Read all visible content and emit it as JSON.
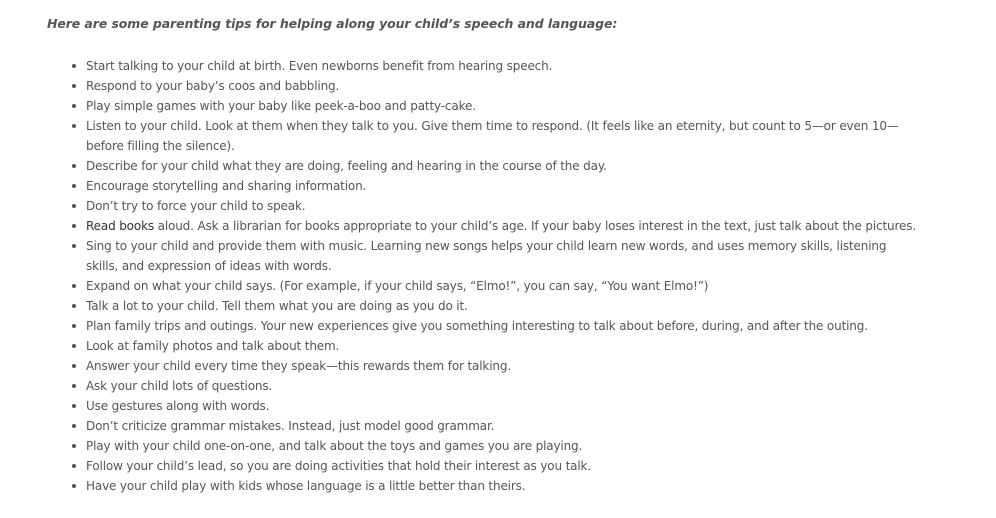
{
  "intro": "Here are some parenting tips for helping along your child’s speech and language:",
  "tips": [
    "Start talking to your child at birth.  Even newborns benefit from hearing speech.",
    "Respond to your baby’s coos and babbling.",
    "Play simple games with your baby like peek-a-boo and patty-cake.",
    "Listen to your child. Look at them when they talk to you. Give them time to respond. (It feels like an eternity, but count to 5—or even 10—before filling the silence).",
    "Describe for your child what they are doing, feeling and hearing in the course of the day.",
    "Encourage storytelling and sharing information.",
    "Don’t try to force your child to speak.",
    {
      "link_text": "Read books",
      "rest": " aloud.  Ask a librarian for books appropriate to your child’s age. If your baby loses interest in the text, just talk about the pictures."
    },
    "Sing to your child and provide them with music.  Learning new songs helps your child learn new words, and uses memory skills, listening skills, and expression of ideas with words.",
    "Expand on what your child says.  (For example, if your child says, “Elmo!”, you can say, “You want Elmo!”)",
    "Talk a lot to your child.  Tell them what you are doing as you do it.",
    "Plan family trips and outings.  Your new experiences give you something interesting to talk about before, during, and after the outing.",
    "Look at family photos and talk about them.",
    "Answer your child every time they speak—this rewards them for talking.",
    "Ask your child lots of questions.",
    "Use gestures along with words.",
    "Don’t criticize grammar mistakes.  Instead, just model good grammar.",
    "Play with your child one-on-one, and talk about the toys and games you are playing.",
    "Follow your child’s lead, so you are doing activities that hold their interest as you talk.",
    "Have your child play with kids whose language is a little better than theirs."
  ]
}
